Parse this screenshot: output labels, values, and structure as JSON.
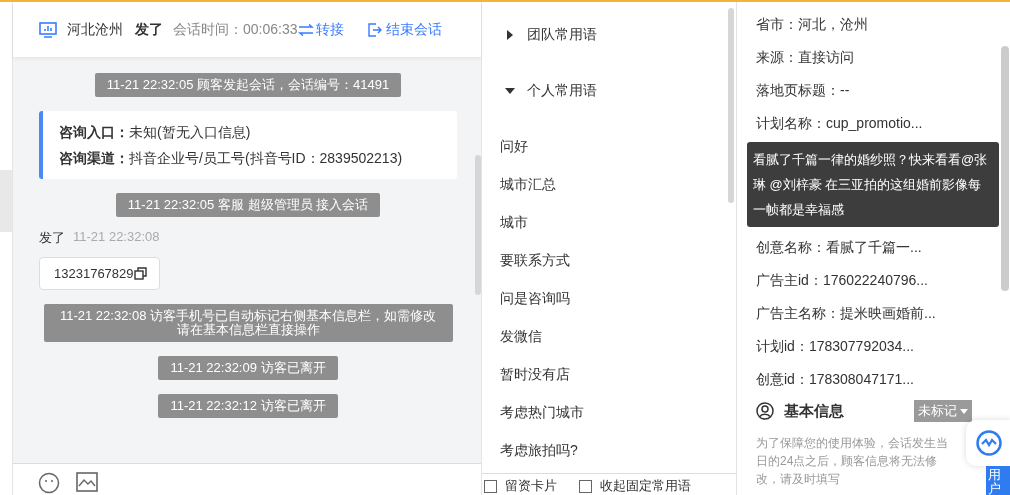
{
  "header": {
    "location": "河北沧州",
    "customer": "发了",
    "session_time_label": "会话时间：",
    "session_time": "00:06:33",
    "transfer": "转接",
    "end_session": "结束会话"
  },
  "chat": {
    "messages": [
      {
        "kind": "system",
        "text": "11-21 22:32:05 顾客发起会话，会话编号：41491"
      },
      {
        "kind": "info_card",
        "rows": [
          {
            "label": "咨询入口：",
            "value": "未知(暂无入口信息)"
          },
          {
            "label": "咨询渠道：",
            "value": "抖音企业号/员工号(抖音号ID：2839502213)"
          }
        ]
      },
      {
        "kind": "system",
        "text": "11-21 22:32:05 客服 超级管理员 接入会话"
      },
      {
        "kind": "customer",
        "sender": "发了",
        "time": "11-21 22:32:08",
        "text": "13231767829"
      },
      {
        "kind": "system",
        "text": "11-21 22:32:08 访客手机号已自动标记右侧基本信息栏，如需修改请在基本信息栏直接操作"
      },
      {
        "kind": "system",
        "text": "11-21 22:32:09 访客已离开"
      },
      {
        "kind": "system",
        "text": "11-21 22:32:12 访客已离开"
      }
    ]
  },
  "quick_phrases": {
    "groups": [
      {
        "label": "团队常用语",
        "expanded": false
      },
      {
        "label": "个人常用语",
        "expanded": true,
        "items": [
          "问好",
          "城市汇总",
          "城市",
          "要联系方式",
          "问是咨询吗",
          "发微信",
          "暂时没有店",
          "考虑热门城市",
          "考虑旅拍吗?"
        ]
      }
    ],
    "options": [
      {
        "label": "留资卡片",
        "checked": false
      },
      {
        "label": "收起固定常用语",
        "checked": false
      }
    ]
  },
  "visitor_info": {
    "rows": [
      {
        "label": "省市：",
        "value": "河北，沧州"
      },
      {
        "label": "来源：",
        "value": "直接访问"
      },
      {
        "label": "落地页标题：",
        "value": "--"
      },
      {
        "label": "计划名称：",
        "value": "cup_promotio..."
      },
      {
        "label": "创意名称：",
        "value": "看腻了千篇一...",
        "tooltip": "看腻了千篇一律的婚纱照？快来看看@张琳 @刘梓豪 在三亚拍的这组婚前影像每一帧都是幸福感"
      },
      {
        "label": "广告主id：",
        "value": "176022240796..."
      },
      {
        "label": "广告主名称：",
        "value": "提米映画婚前..."
      },
      {
        "label": "计划id：",
        "value": "178307792034..."
      },
      {
        "label": "创意id：",
        "value": "178308047171..."
      }
    ],
    "basic_info": {
      "title": "基本信息",
      "tag": "未标记",
      "note": "为了保障您的使用体验，会话发生当日的24点之后，顾客信息将无法修改，请及时填写"
    }
  },
  "floating": {
    "label": "用户"
  }
}
